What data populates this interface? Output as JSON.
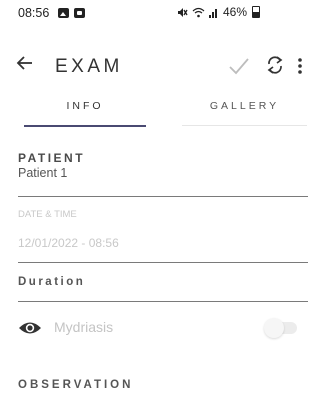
{
  "status_bar": {
    "time": "08:56",
    "battery": "46%",
    "left_icons": [
      "gallery-icon",
      "square-icon"
    ],
    "right_icons": [
      "mute-icon",
      "wifi-icon",
      "signal-icon",
      "battery-icon"
    ]
  },
  "app_bar": {
    "title": "EXAM",
    "icons": [
      "back-arrow-icon",
      "check-icon",
      "refresh-icon",
      "more-vert-icon"
    ]
  },
  "tabs": [
    {
      "label": "INFO",
      "active": true
    },
    {
      "label": "GALLERY",
      "active": false
    }
  ],
  "form": {
    "patient_label": "PATIENT",
    "patient_value": "Patient 1",
    "datetime_label": "DATE & TIME",
    "datetime_value": "12/01/2022 - 08:56",
    "duration_label": "Duration",
    "mydriasis_label": "Mydriasis",
    "mydriasis_on": false,
    "observation_label": "OBSERVATION"
  },
  "colors": {
    "accent": "#4a4a72",
    "disabled_text": "#c8c8c8",
    "field_line": "#7a7a7a"
  }
}
